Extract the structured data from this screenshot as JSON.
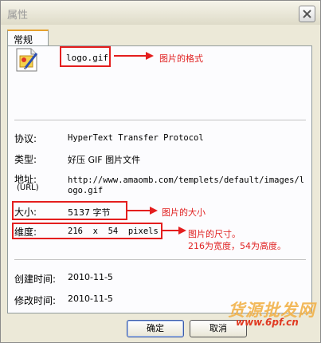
{
  "window": {
    "title": "属性"
  },
  "tab": {
    "label": "常规"
  },
  "file": {
    "name": "logo.gif",
    "icon": "gif-image-file-icon"
  },
  "annotations": {
    "format": "图片的格式",
    "size": "图片的大小",
    "dimensions_line1": "图片的尺寸。",
    "dimensions_line2": "216为宽度，54为高度。"
  },
  "properties": {
    "protocol_label": "协议:",
    "protocol_value": "HyperText Transfer Protocol",
    "type_label": "类型:",
    "type_value": "好压 GIF 图片文件",
    "address_label": "地址:",
    "address_sub": "(URL)",
    "address_line1": "http://www.amaomb.com/templets/default/images/l",
    "address_line2": "ogo.gif",
    "size_label": "大小:",
    "size_value": "5137 字节",
    "dimension_label": "维度:",
    "dimension_value": "216  x  54  pixels",
    "created_label": "创建时间:",
    "created_value": "2010-11-5",
    "modified_label": "修改时间:",
    "modified_value": "2010-11-5"
  },
  "buttons": {
    "ok": "确定",
    "cancel": "取消"
  },
  "watermark": {
    "line1": "货源批发网",
    "line2": "www.6pf.cn"
  },
  "colors": {
    "annotation_red": "#e41e1e",
    "tab_accent": "#e6a12e"
  }
}
